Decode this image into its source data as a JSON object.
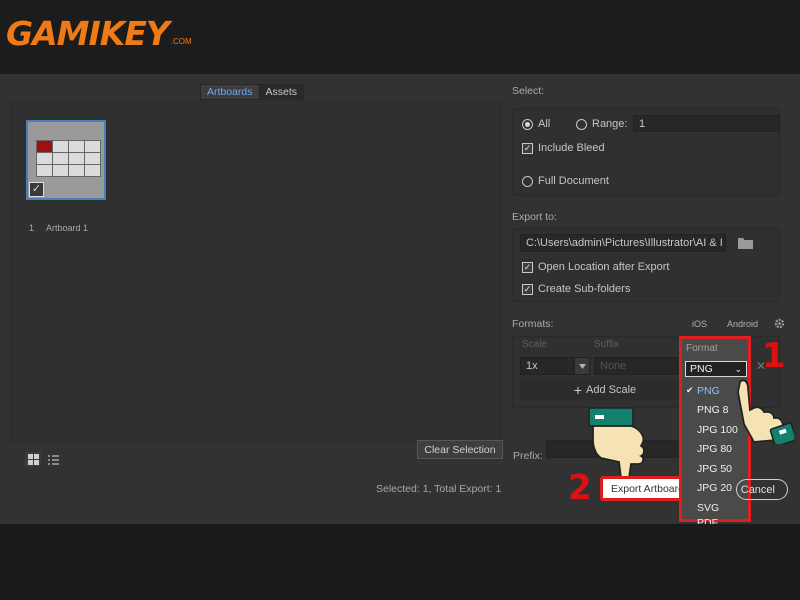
{
  "logo": {
    "text": "GAMIKEY",
    "suffix": ".COM"
  },
  "left": {
    "tabs": [
      {
        "label": "Artboards",
        "active": true
      },
      {
        "label": "Assets",
        "active": false
      }
    ],
    "artboard": {
      "number": "1",
      "name": "Artboard 1",
      "checked": true
    },
    "clear_selection": "Clear Selection",
    "status": "Selected: 1, Total Export: 1"
  },
  "select": {
    "label": "Select:",
    "all": "All",
    "range": "Range:",
    "range_value": "1",
    "include_bleed": "Include Bleed",
    "full_document": "Full Document"
  },
  "export_to": {
    "label": "Export to:",
    "path": "C:\\Users\\admin\\Pictures\\Illustrator\\AI & I",
    "open_location": "Open Location after Export",
    "create_subfolders": "Create Sub-folders"
  },
  "formats": {
    "label": "Formats:",
    "ios": "iOS",
    "android": "Android",
    "scale_header": "Scale",
    "suffix_header": "Suffix",
    "format_header": "Format",
    "scale_value": "1x",
    "suffix_placeholder": "None",
    "add_scale": "Add Scale",
    "selected_format": "PNG",
    "options": [
      "PNG",
      "PNG 8",
      "JPG 100",
      "JPG 80",
      "JPG 50",
      "JPG 20",
      "SVG",
      "PDF"
    ]
  },
  "prefix_label": "Prefix:",
  "buttons": {
    "export": "Export Artboard",
    "cancel": "Cancel"
  },
  "annotations": {
    "step1": "1",
    "step2": "2"
  },
  "colors": {
    "accent_red": "#e01e1e",
    "logo_orange": "#f07a16",
    "link_blue": "#6ea8e8"
  }
}
